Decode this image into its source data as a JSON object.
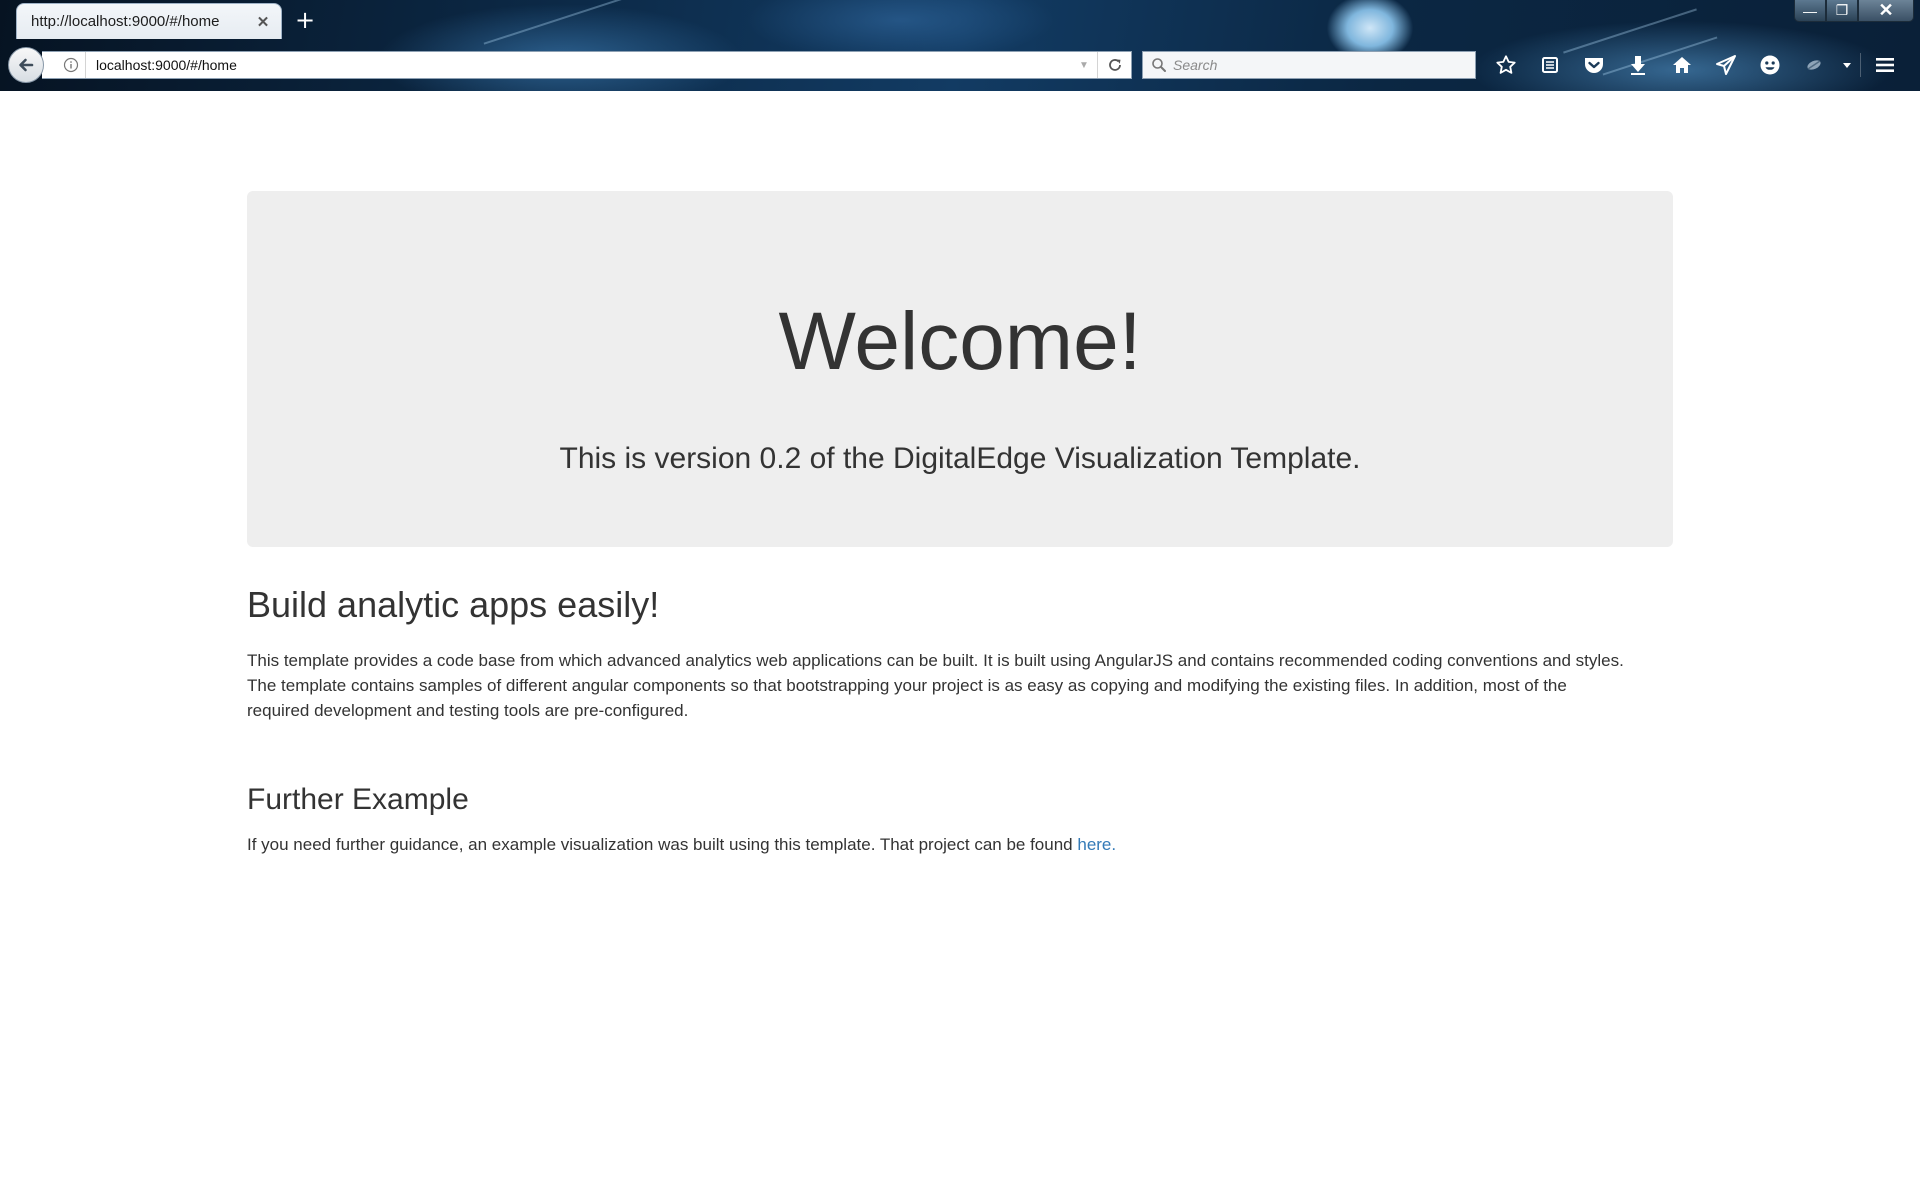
{
  "browser": {
    "tab": {
      "title": "http://localhost:9000/#/home",
      "close_icon": "close-icon"
    },
    "new_tab_label": "+",
    "window_controls": {
      "minimize": "—",
      "restore": "❐",
      "close": "✕"
    },
    "url": "localhost:9000/#/home",
    "search": {
      "placeholder": "Search",
      "value": ""
    },
    "toolbar_icons": [
      "bookmark-star-icon",
      "reading-list-icon",
      "pocket-icon",
      "download-icon",
      "home-icon",
      "share-icon",
      "emoji-icon",
      "extension-icon",
      "overflow-dropdown-icon",
      "hamburger-menu-icon"
    ]
  },
  "page": {
    "jumbotron": {
      "title": "Welcome!",
      "subtitle": "This is version 0.2 of the DigitalEdge Visualization Template."
    },
    "section1": {
      "heading": "Build analytic apps easily!",
      "line1": "This template provides a code base from which advanced analytics web applications can be built. It is built using AngularJS and contains recommended coding conventions and styles.",
      "line2": "The template contains samples of different angular components so that bootstrapping your project is as easy as copying and modifying the existing files. In addition, most of the",
      "line3": "required development and testing tools are pre-configured."
    },
    "section2": {
      "heading": "Further Example",
      "text": "If you need further guidance, an example visualization was built using this template. That project can be found ",
      "link_label": "here."
    }
  },
  "colors": {
    "jumbotron_bg": "#eeeeee",
    "text": "#333333",
    "link": "#337ab7",
    "chrome_dark": "#0c2a48"
  }
}
